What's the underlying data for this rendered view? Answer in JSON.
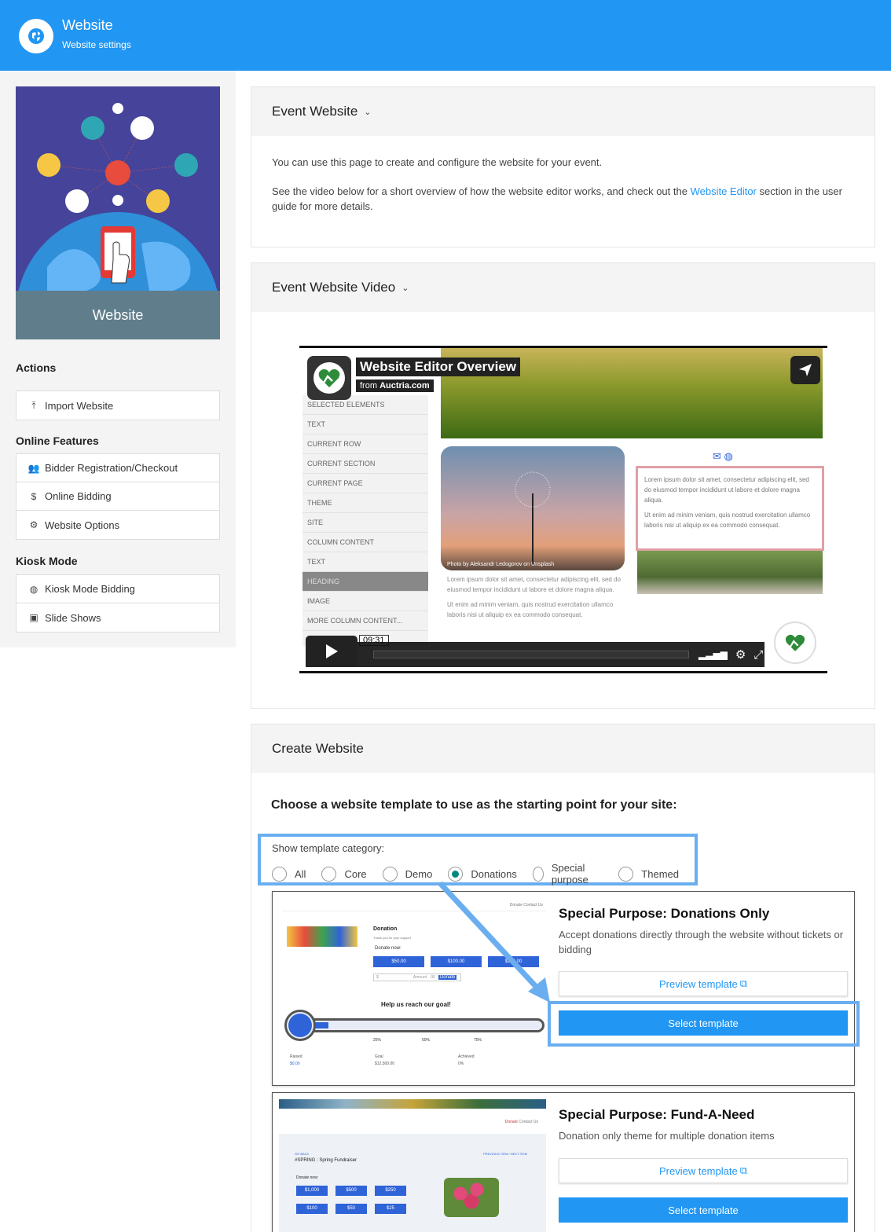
{
  "header": {
    "title": "Website",
    "subtitle": "Website settings",
    "icon": "globe-icon"
  },
  "sidebar": {
    "hero_caption": "Website",
    "sections": [
      {
        "heading": "Actions",
        "items": [
          {
            "label": "Import Website",
            "icon": "upload-icon"
          }
        ]
      },
      {
        "heading": "Online Features",
        "items": [
          {
            "label": "Bidder Registration/Checkout",
            "icon": "people-icon"
          },
          {
            "label": "Online Bidding",
            "icon": "dollar-icon"
          },
          {
            "label": "Website Options",
            "icon": "gear-icon"
          }
        ]
      },
      {
        "heading": "Kiosk Mode",
        "items": [
          {
            "label": "Kiosk Mode Bidding",
            "icon": "globe-icon"
          },
          {
            "label": "Slide Shows",
            "icon": "slideshow-icon"
          }
        ]
      }
    ]
  },
  "panels": {
    "event_website": {
      "title": "Event Website",
      "p1": "You can use this page to create and configure the website for your event.",
      "p2_before": "See the video below for a short overview of how the website editor works, and check out the ",
      "p2_link": "Website Editor",
      "p2_after": " section in the user guide for more details."
    },
    "event_video": {
      "title": "Event Website Video",
      "video_title": "Website Editor Overview",
      "video_from": "from",
      "video_from_site": "Auctria.com",
      "time": "09:31",
      "editor_rows": [
        "SELECTED ELEMENTS",
        "TEXT",
        "CURRENT ROW",
        "CURRENT SECTION",
        "CURRENT PAGE",
        "THEME",
        "SITE",
        "COLUMN CONTENT",
        "TEXT",
        "HEADING",
        "IMAGE",
        "MORE COLUMN CONTENT..."
      ],
      "photo_credit": "Photo by Aleksandr Ledogorov on Unsplash",
      "lorem1": "Lorem ipsum dolor sit amet, consectetur adipiscing elit, sed do eiusmod tempor incididunt ut labore et dolore magna aliqua.",
      "lorem2": "Ut enim ad minim veniam, quis nostrud exercitation ullamco laboris nisi ut aliquip ex ea commodo consequat."
    },
    "create_website": {
      "title": "Create Website",
      "choose": "Choose a website template to use as the starting point for your site:",
      "category_label": "Show template category:",
      "categories": [
        "All",
        "Core",
        "Demo",
        "Donations",
        "Special purpose",
        "Themed"
      ],
      "selected_category": "Donations",
      "templates": [
        {
          "name": "Special Purpose: Donations Only",
          "desc": "Accept donations directly through the website without tickets or bidding",
          "preview_label": "Preview template",
          "select_label": "Select template",
          "mock": {
            "nav": [
              "Donate",
              "Contact Us"
            ],
            "heading": "Donation",
            "thanks": "Thank you for your support",
            "donate_now": "Donate now:",
            "amounts": [
              "$50.00",
              "$100.00",
              "$200.00"
            ],
            "currency": "$",
            "amount_placeholder": "Amount",
            "cents": ".00",
            "donate_btn": "Donate",
            "goal_text": "Help us reach our goal!",
            "ticks": [
              "25%",
              "50%",
              "75%"
            ],
            "stats": [
              {
                "label": "Raised",
                "value": "$0.00"
              },
              {
                "label": "Goal",
                "value": "$12,500.00"
              },
              {
                "label": "Achieved",
                "value": "0%"
              }
            ]
          }
        },
        {
          "name": "Special Purpose: Fund-A-Need",
          "desc": "Donation only theme for multiple donation items",
          "preview_label": "Preview template",
          "select_label": "Select template",
          "mock": {
            "nav": [
              "Donate",
              "Contact Us"
            ],
            "back": "GO BACK",
            "pager": "PREVIOUS ITEM / NEXT ITEM",
            "title": "#SPRING : Spring Fundraiser",
            "donate_now": "Donate now:",
            "amounts": [
              "$1,000",
              "$500",
              "$250",
              "$100",
              "$50",
              "$25"
            ]
          }
        }
      ]
    }
  },
  "colors": {
    "primary": "#2196f3",
    "sidebar_bg": "#f4f4f4",
    "hero_bg": "#45449a",
    "caption_bg": "#607d8b",
    "highlight": "#6aaef0",
    "radio_on": "#00897b"
  }
}
